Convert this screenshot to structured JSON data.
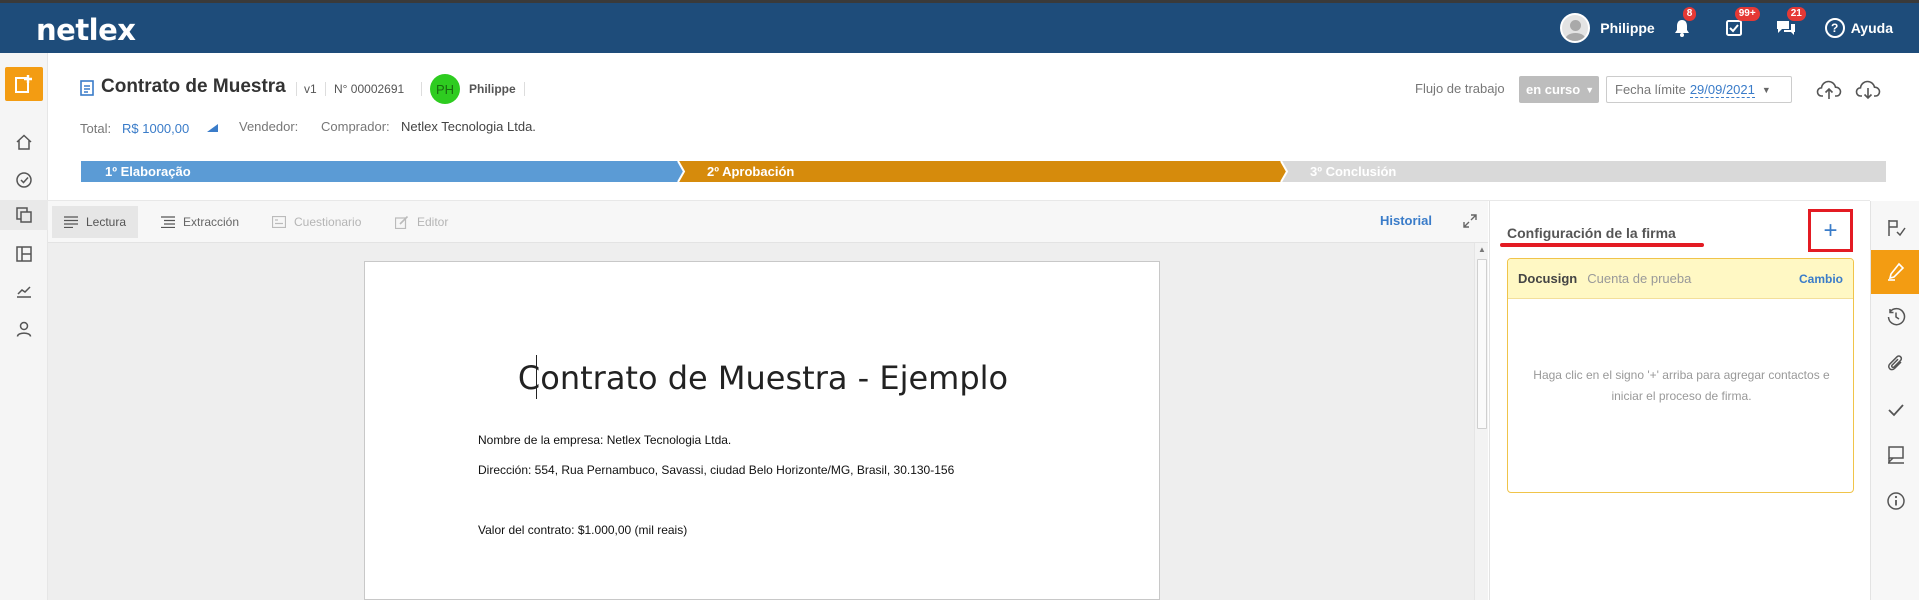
{
  "app": {
    "logo": "netlex"
  },
  "topbar": {
    "user_name": "Philippe",
    "notifications_badge": "8",
    "tasks_badge": "99+",
    "messages_badge": "21",
    "help_label": "Ayuda"
  },
  "header": {
    "title": "Contrato de Muestra",
    "version": "v1",
    "number": "N° 00002691",
    "owner_initials": "PH",
    "owner_name": "Philippe",
    "total_label": "Total:",
    "total_value": "R$ 1000,00",
    "seller_label": "Vendedor:",
    "buyer_label": "Comprador:",
    "buyer_value": "Netlex Tecnologia Ltda.",
    "workflow_label": "Flujo de trabajo",
    "workflow_status": "en curso",
    "deadline_label": "Fecha límite",
    "deadline_date": "29/09/2021"
  },
  "phases": [
    {
      "label": "1º Elaboração",
      "color": "#5b9bd5"
    },
    {
      "label": "2º Aprobación",
      "color": "#d68b0c"
    },
    {
      "label": "3º Conclusión",
      "color": "#d9d9d9"
    }
  ],
  "editor_tabs": [
    {
      "label": "Lectura",
      "icon": "reading-lines-icon",
      "state": "active"
    },
    {
      "label": "Extracción",
      "icon": "extraction-list-icon",
      "state": "normal"
    },
    {
      "label": "Cuestionario",
      "icon": "questionnaire-icon",
      "state": "disabled"
    },
    {
      "label": "Editor",
      "icon": "edit-pencil-icon",
      "state": "disabled"
    }
  ],
  "history_label": "Historial",
  "document": {
    "title": "Contrato de Muestra - Ejemplo",
    "lines": [
      "Nombre de la empresa: Netlex Tecnologia Ltda.",
      "Dirección: 554, Rua Pernambuco, Savassi, ciudad Belo Horizonte/MG, Brasil, 30.130-156",
      "Valor del contrato: $1.000,00 (mil reais)"
    ]
  },
  "signature_panel": {
    "title": "Configuración de la firma",
    "add_symbol": "+",
    "provider": "Docusign",
    "account": "Cuenta de prueba",
    "change_label": "Cambio",
    "empty_message": "Haga clic en el signo '+' arriba para agregar contactos e iniciar el proceso de firma."
  },
  "colors": {
    "topbar": "#1e4c7a",
    "accent_orange": "#f39c12",
    "link_blue": "#3a7cc9",
    "highlight_red": "#e31b23"
  }
}
